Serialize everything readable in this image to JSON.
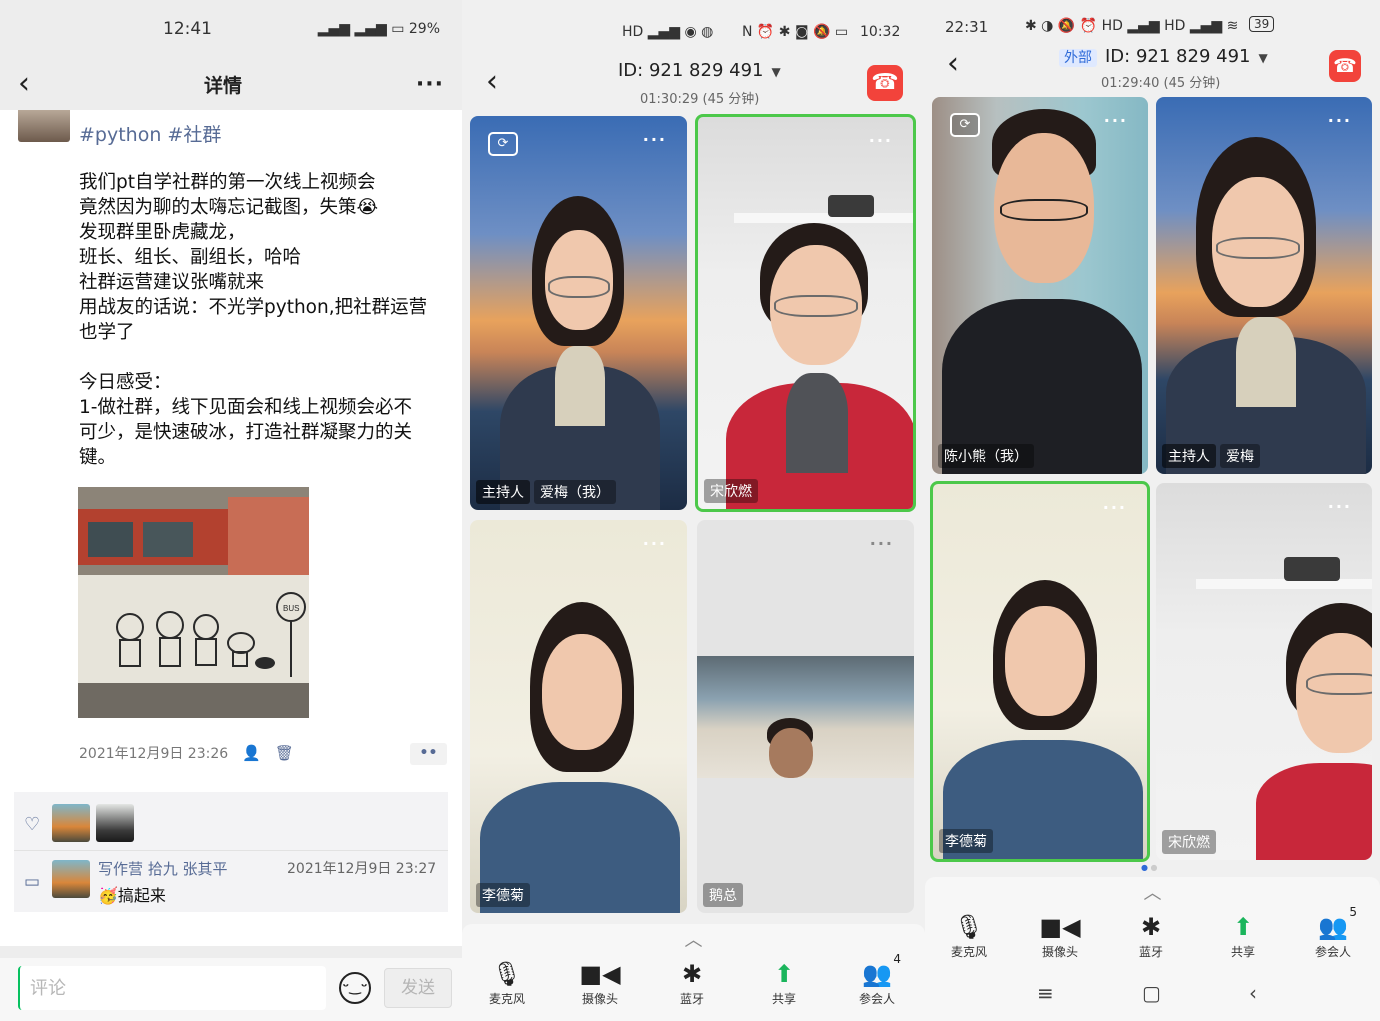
{
  "panel1": {
    "status": {
      "time": "12:41",
      "battery": "29%"
    },
    "nav": {
      "title": "详情",
      "back_icon": "‹",
      "more_icon": "···"
    },
    "tags": "#python #社群",
    "post_lines": [
      "我们pt自学社群的第一次线上视频会",
      "竟然因为聊的太嗨忘记截图，失策😭",
      "发现群里卧虎藏龙，",
      "班长、组长、副组长，哈哈",
      "社群运营建议张嘴就来",
      "用战友的话说：不光学python,把社群运营",
      "也学了",
      "",
      "今日感受：",
      "1-做社群，线下见面会和线上视频会必不",
      "可少，是快速破冰，打造社群凝聚力的关",
      "键。"
    ],
    "timestamp": "2021年12月9日 23:26",
    "comment": {
      "names": "写作营 拾九 张其平",
      "time": "2021年12月9日 23:27",
      "text": "🥳搞起来"
    },
    "footer": {
      "placeholder": "评论",
      "send": "发送"
    }
  },
  "panel2": {
    "status": {
      "time": "10:32"
    },
    "meeting_id": "ID: 921 829 491",
    "duration": "01:30:29 (45 分钟)",
    "tiles": [
      {
        "host": "主持人",
        "name": "爱梅（我）"
      },
      {
        "name": "宋欣燃"
      },
      {
        "name": "李德菊"
      },
      {
        "name": "鹅总"
      }
    ],
    "toolbar": {
      "mic": "麦克风",
      "camera": "摄像头",
      "bluetooth": "蓝牙",
      "share": "共享",
      "participants": "参会人",
      "participant_count": "4"
    }
  },
  "panel3": {
    "status": {
      "time": "22:31",
      "battery": "39"
    },
    "external": "外部",
    "meeting_id": "ID: 921 829 491",
    "duration": "01:29:40 (45 分钟)",
    "tiles": [
      {
        "name": "陈小熊（我）"
      },
      {
        "host": "主持人",
        "name": "爱梅"
      },
      {
        "name": "李德菊"
      },
      {
        "name": "宋欣燃"
      }
    ],
    "toolbar": {
      "mic": "麦克风",
      "camera": "摄像头",
      "bluetooth": "蓝牙",
      "share": "共享",
      "participants": "参会人",
      "participant_count": "5"
    }
  },
  "colors": {
    "link_blue": "#576b95",
    "hangup_red": "#f2433b",
    "speaking_green": "#4cc84a",
    "wechat_green": "#07c160"
  }
}
